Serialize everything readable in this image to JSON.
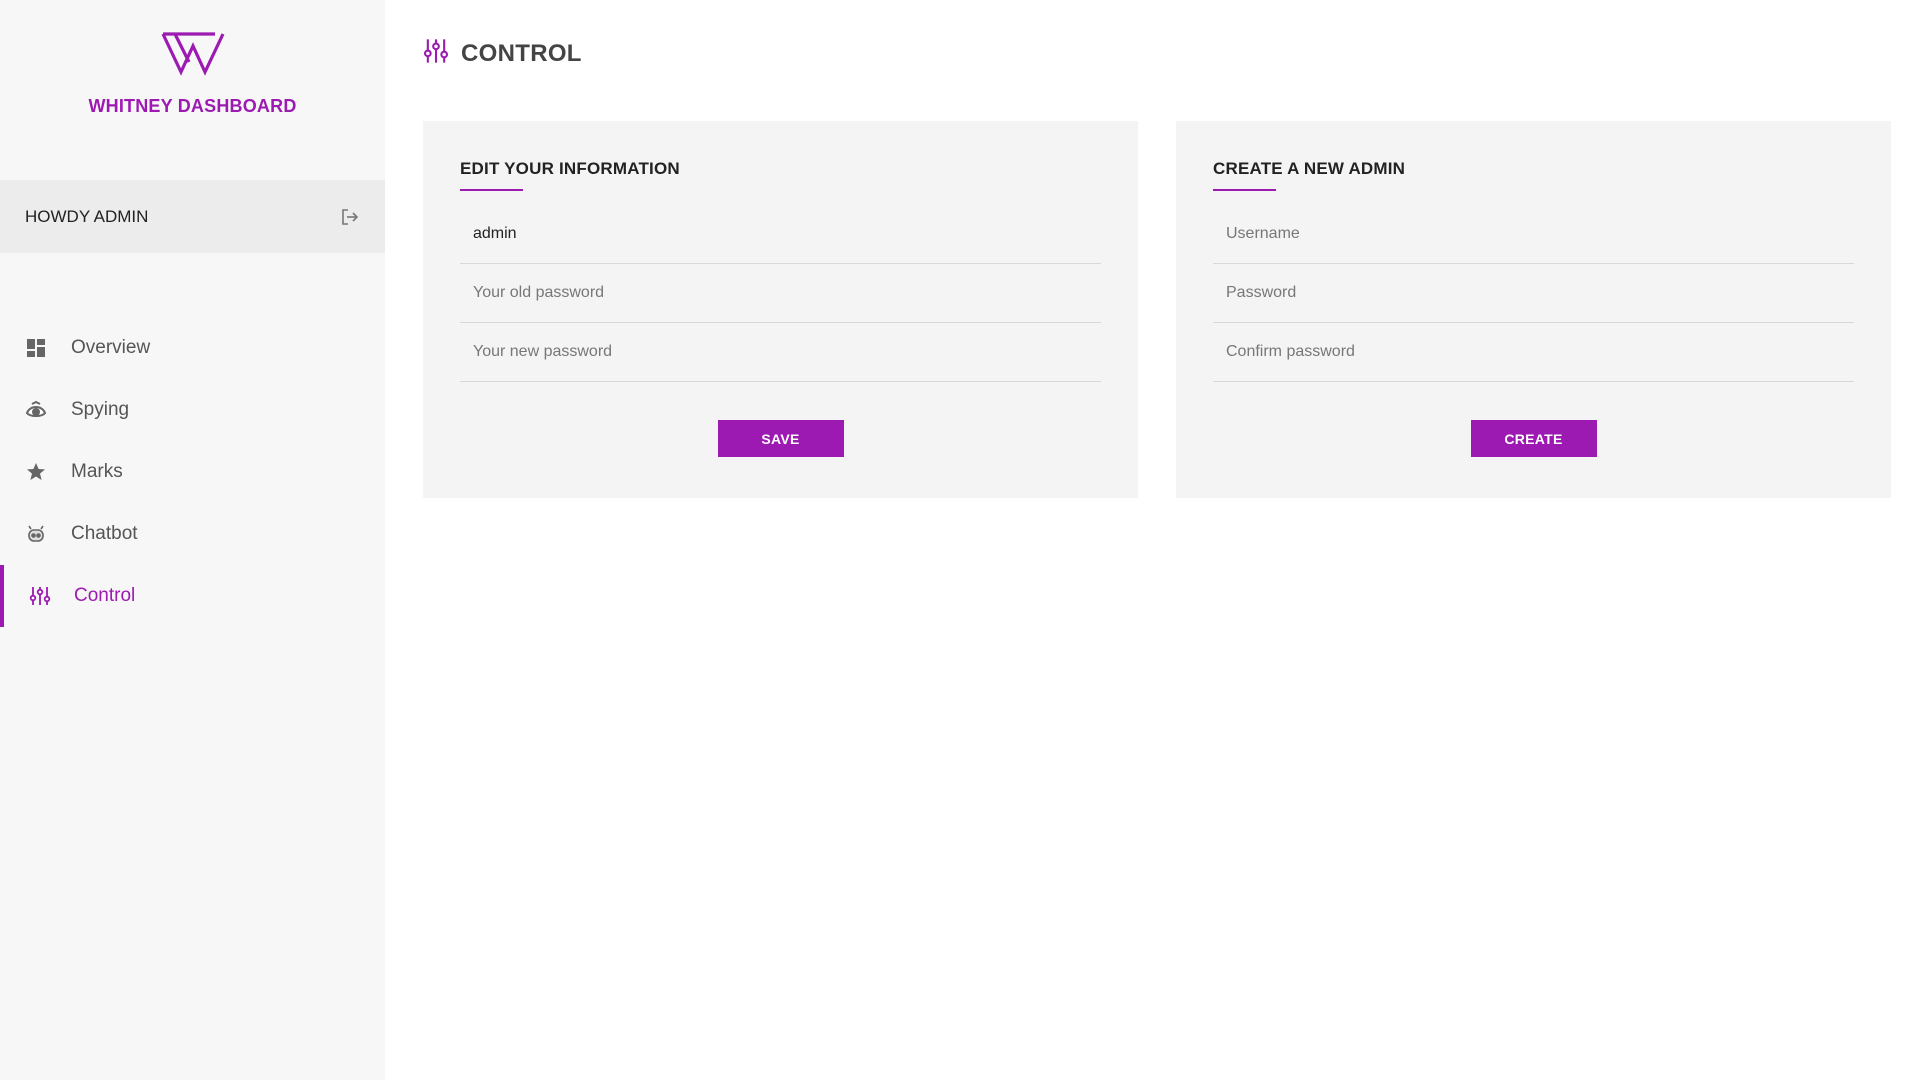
{
  "brand": {
    "name": "WHITNEY DASHBOARD",
    "logo_icon": "whitney-w-logo",
    "accent_color": "#9c1ab1"
  },
  "user_bar": {
    "greeting": "HOWDY ADMIN",
    "logout_icon": "logout-icon"
  },
  "sidebar": {
    "items": [
      {
        "label": "Overview",
        "icon": "dashboard-grid-icon",
        "active": false
      },
      {
        "label": "Spying",
        "icon": "eye-icon",
        "active": false
      },
      {
        "label": "Marks",
        "icon": "star-icon",
        "active": false
      },
      {
        "label": "Chatbot",
        "icon": "robot-icon",
        "active": false
      },
      {
        "label": "Control",
        "icon": "sliders-icon",
        "active": true
      }
    ]
  },
  "header": {
    "title": "CONTROL",
    "icon": "sliders-icon"
  },
  "edit_card": {
    "title": "EDIT YOUR INFORMATION",
    "username_value": "admin",
    "old_password_placeholder": "Your old password",
    "new_password_placeholder": "Your new password",
    "save_label": "SAVE"
  },
  "create_card": {
    "title": "CREATE A NEW ADMIN",
    "username_placeholder": "Username",
    "password_placeholder": "Password",
    "confirm_placeholder": "Confirm password",
    "create_label": "CREATE"
  }
}
